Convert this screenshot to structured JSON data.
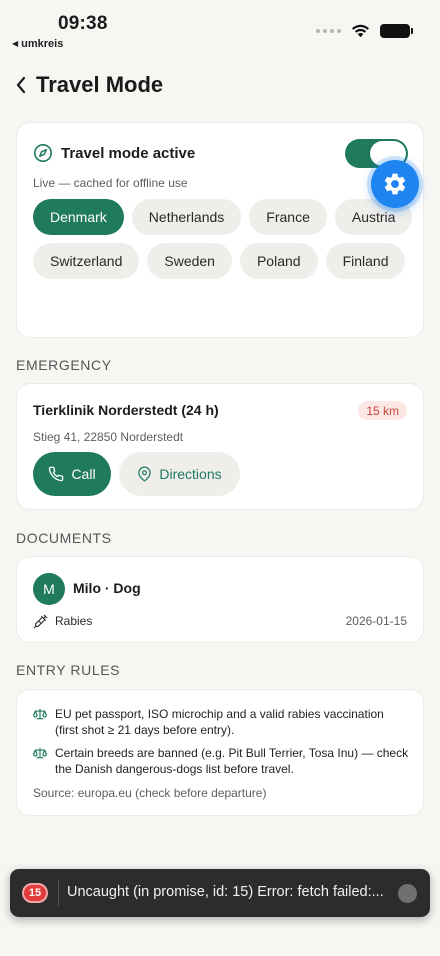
{
  "status_bar": {
    "time": "09:38",
    "back_app": "umkreis"
  },
  "header": {
    "title": "Travel Mode"
  },
  "travel_mode": {
    "title": "Travel mode active",
    "subtitle": "Live — cached for offline use",
    "enabled": true,
    "countries": [
      {
        "label": "Denmark",
        "selected": true
      },
      {
        "label": "Netherlands",
        "selected": false
      },
      {
        "label": "France",
        "selected": false
      },
      {
        "label": "Austria",
        "selected": false
      },
      {
        "label": "Switzerland",
        "selected": false
      },
      {
        "label": "Sweden",
        "selected": false
      },
      {
        "label": "Poland",
        "selected": false
      },
      {
        "label": "Finland",
        "selected": false
      }
    ]
  },
  "emergency": {
    "section_label": "EMERGENCY",
    "clinic_name": "Tierklinik Norderstedt (24 h)",
    "distance": "15 km",
    "address": "Stieg 41, 22850 Norderstedt",
    "call_label": "Call",
    "directions_label": "Directions"
  },
  "documents": {
    "section_label": "DOCUMENTS",
    "avatar_initial": "M",
    "pet_name": "Milo · Dog",
    "vaccination": "Rabies",
    "vaccination_date": "2026-01-15"
  },
  "entry_rules": {
    "section_label": "ENTRY RULES",
    "rules": [
      "EU pet passport, ISO microchip and a valid rabies vaccination (first shot ≥ 21 days before entry).",
      "Certain breeds are banned (e.g. Pit Bull Terrier, Tosa Inu) — check the Danish dangerous-dogs list before travel."
    ],
    "source": "Source: europa.eu (check before departure)"
  },
  "error_toast": {
    "count": "15",
    "message": "Uncaught (in promise, id: 15) Error: fetch failed:..."
  },
  "colors": {
    "accent": "#1f7a5e",
    "fab": "#1e84f0",
    "danger": "#c0463a",
    "background": "#f7f6f3"
  }
}
